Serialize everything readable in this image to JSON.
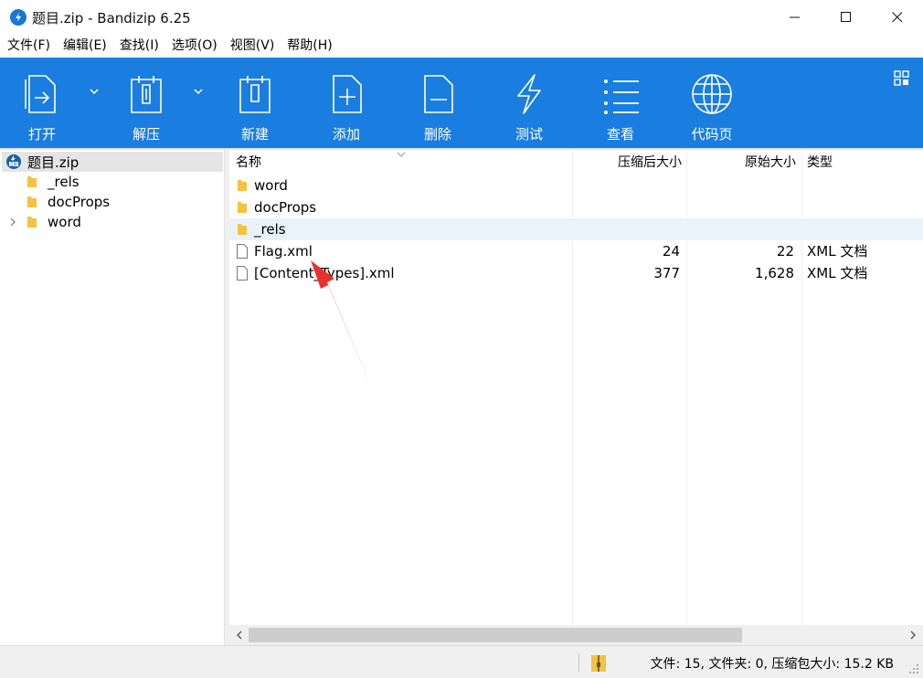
{
  "window": {
    "title": "题目.zip - Bandizip 6.25"
  },
  "menu": [
    "文件(F)",
    "编辑(E)",
    "查找(I)",
    "选项(O)",
    "视图(V)",
    "帮助(H)"
  ],
  "toolbar": {
    "open": "打开",
    "extract": "解压",
    "new": "新建",
    "add": "添加",
    "delete": "删除",
    "test": "测试",
    "view": "查看",
    "codepage": "代码页"
  },
  "tree": {
    "root": "题目.zip",
    "items": [
      "_rels",
      "docProps",
      "word"
    ]
  },
  "columns": {
    "name": "名称",
    "compressed": "压缩后大小",
    "original": "原始大小",
    "type": "类型"
  },
  "files": [
    {
      "name": "word",
      "compressed": "",
      "original": "",
      "type": "",
      "kind": "folder"
    },
    {
      "name": "docProps",
      "compressed": "",
      "original": "",
      "type": "",
      "kind": "folder"
    },
    {
      "name": "_rels",
      "compressed": "",
      "original": "",
      "type": "",
      "kind": "folder"
    },
    {
      "name": "Flag.xml",
      "compressed": "24",
      "original": "22",
      "type": "XML 文档",
      "kind": "file"
    },
    {
      "name": "[Content_Types].xml",
      "compressed": "377",
      "original": "1,628",
      "type": "XML 文档",
      "kind": "file"
    }
  ],
  "status": {
    "text": "文件: 15, 文件夹: 0, 压缩包大小: 15.2 KB"
  },
  "colors": {
    "toolbar_bg": "#1a7de0",
    "folder": "#f5c242",
    "annotation_arrow": "#e8302c",
    "row_highlight": "#e9f3fc"
  }
}
